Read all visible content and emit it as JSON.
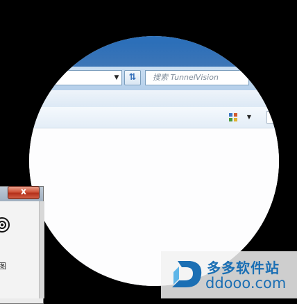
{
  "explorer": {
    "search_placeholder": "搜索 TunnelVision",
    "refresh_icon": "refresh-arrows-icon",
    "address_dropdown_icon": "chevron-down-icon",
    "view_icon": "view-mode-icon"
  },
  "dialog": {
    "close_label": "x",
    "partial_text": "图"
  },
  "watermark": {
    "name": "多多软件站",
    "url": "ddooo.com"
  },
  "colors": {
    "title_blue": "#2e73bd",
    "close_red": "#cf5339",
    "watermark_blue": "#1b6fb4"
  }
}
